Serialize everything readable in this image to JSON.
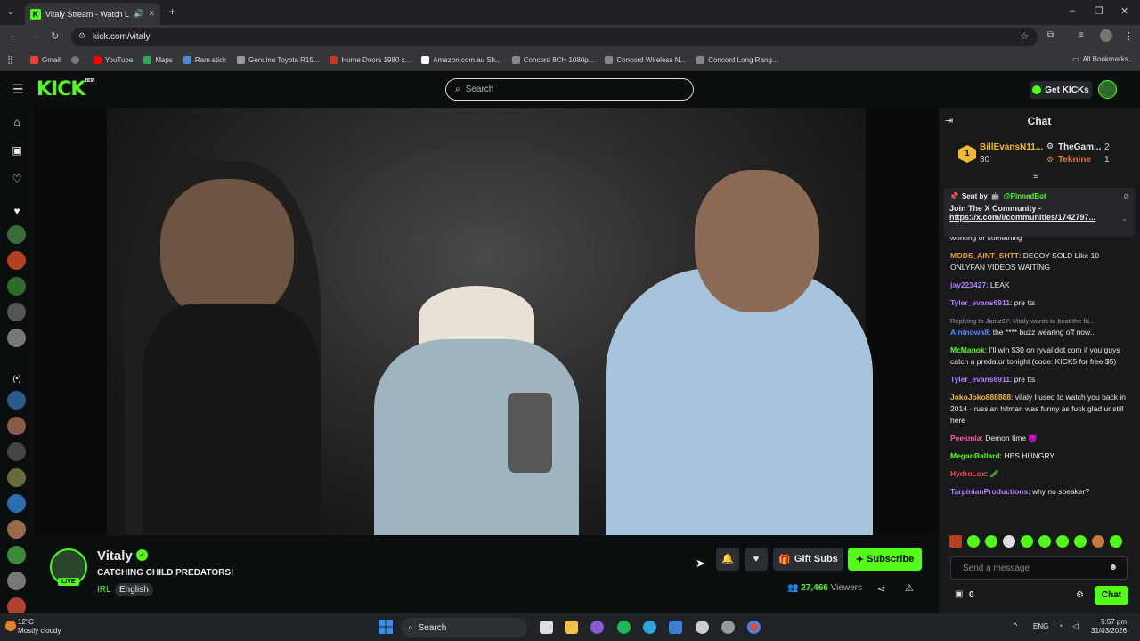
{
  "browser": {
    "tab_title": "Vitaly Stream - Watch Live",
    "url": "kick.com/vitaly",
    "bookmarks": [
      {
        "label": "Gmail",
        "color": "#ea4335"
      },
      {
        "label": "",
        "color": "#777777"
      },
      {
        "label": "YouTube",
        "color": "#ff0000"
      },
      {
        "label": "Maps",
        "color": "#34a853"
      },
      {
        "label": "Ram stick",
        "color": "#4d8bd6"
      },
      {
        "label": "Genuine Toyota R15...",
        "color": "#999999"
      },
      {
        "label": "Hume Doors 1980 x...",
        "color": "#c0392b"
      },
      {
        "label": "Amazon.com.au Sh...",
        "color": "#ffffff"
      },
      {
        "label": "Concord 8CH 1080p...",
        "color": "#888888"
      },
      {
        "label": "Concord Wireless N...",
        "color": "#888888"
      },
      {
        "label": "Concord Long Rang...",
        "color": "#888888"
      }
    ],
    "all_bookmarks": "All Bookmarks"
  },
  "header": {
    "logo": "KICK",
    "beta": "BETA",
    "search_placeholder": "Search",
    "get_kicks": "Get KICKs"
  },
  "stream": {
    "channel": "Vitaly",
    "live_badge": "LIVE",
    "title": "CATCHING CHILD PREDATORS!",
    "category": "IRL",
    "language": "English",
    "gift_subs": "Gift Subs",
    "subscribe": "Subscribe",
    "viewers_count": "27,466",
    "viewers_label": "Viewers"
  },
  "chat": {
    "header": "Chat",
    "leaderboard": [
      {
        "rank": "1",
        "name": "BillEvansN11...",
        "count": "30"
      },
      {
        "name": "TheGam...",
        "count": "2"
      },
      {
        "name": "Teknine",
        "count": "1"
      }
    ],
    "pinned": {
      "sent_by_label": "Sent by",
      "sender": "@PinnedBot",
      "text": "Join The X Community -",
      "link": "https://x.com/i/communities/1742797..."
    },
    "messages": [
      {
        "user": "",
        "text": "working or something",
        "color": "#e7e9ea"
      },
      {
        "user": "MODS_AINT_SHTT",
        "text": ": DECOY SOLD Like 10 ONLYFAN VIDEOS WAITING",
        "color": "#f39c32"
      },
      {
        "user": "jay223427",
        "text": ": LEAK",
        "color": "#b47cff"
      },
      {
        "user": "Tyler_evans6911",
        "text": ": pre tts",
        "color": "#b47cff"
      },
      {
        "user": "",
        "text": "Replying to Jamz97: Vitaly wants to beat the fu...",
        "color": "#9aa0a6",
        "reply": true
      },
      {
        "user": "Aintnowa8",
        "text": ": the **** buzz wearing off now...",
        "color": "#4d8bff"
      },
      {
        "user": "McManok",
        "text": ": I'll win $30 on ryval dot com if you guys catch a predator tonight (code: KICK5 for free $5)",
        "color": "#53fc18"
      },
      {
        "user": "Tyler_evans6911",
        "text": ": pre tts",
        "color": "#b47cff"
      },
      {
        "user": "JokoJoko888888",
        "text": ": vitaly I used to watch you back in 2014 - russian hitman was funny as fuck glad ur still here",
        "color": "#f3b832"
      },
      {
        "user": "Peekmia",
        "text": ": Demon time 👿",
        "color": "#ff5bb0"
      },
      {
        "user": "MeganBallard",
        "text": ": HES HUNGRY",
        "color": "#53fc18"
      },
      {
        "user": "HydroLox",
        "text": ": 🥒",
        "color": "#ff4646"
      },
      {
        "user": "TarpinianProductions",
        "text": ": why no speaker?",
        "color": "#b47cff"
      }
    ],
    "send_placeholder": "Send a message",
    "points": "0",
    "chat_button": "Chat"
  },
  "taskbar": {
    "temp": "12°C",
    "weather": "Mostly cloudy",
    "search": "Search",
    "lang": "ENG",
    "time": "5:57 pm",
    "date": "31/03/2026"
  }
}
